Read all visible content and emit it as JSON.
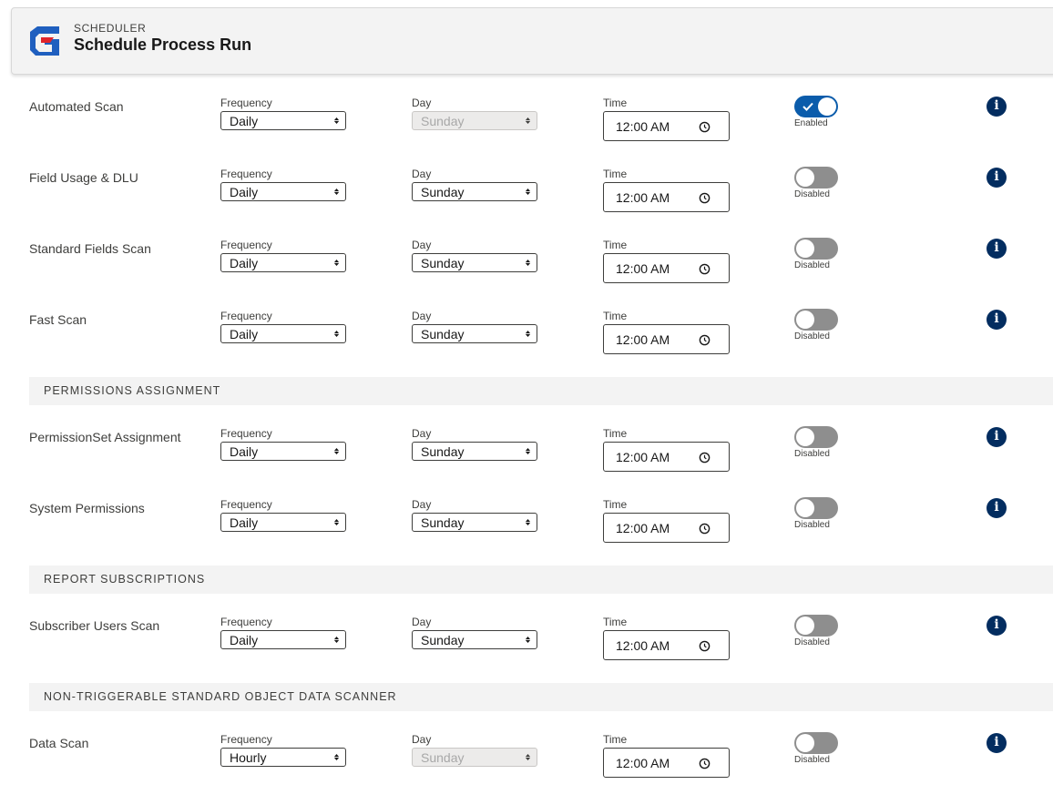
{
  "header": {
    "eyebrow": "SCHEDULER",
    "title": "Schedule Process Run"
  },
  "colors": {
    "accent": "#0b5cab",
    "info": "#032d60",
    "toggle_off": "#8e8e8e",
    "logo_blue": "#1f5fbf",
    "logo_red": "#e0252b"
  },
  "labels": {
    "frequency": "Frequency",
    "day": "Day",
    "time": "Time"
  },
  "sections": [
    {
      "title": "PERMISSIONS ASSIGNMENT"
    },
    {
      "title": "REPORT SUBSCRIPTIONS"
    },
    {
      "title": "NON-TRIGGERABLE STANDARD OBJECT DATA SCANNER"
    }
  ],
  "rows": [
    {
      "name": "Automated Scan",
      "frequency": "Daily",
      "day": "Sunday",
      "day_disabled": true,
      "time": "12:00 AM",
      "enabled": true,
      "status": "Enabled"
    },
    {
      "name": "Field Usage & DLU",
      "frequency": "Daily",
      "day": "Sunday",
      "day_disabled": false,
      "time": "12:00 AM",
      "enabled": false,
      "status": "Disabled"
    },
    {
      "name": "Standard Fields Scan",
      "frequency": "Daily",
      "day": "Sunday",
      "day_disabled": false,
      "time": "12:00 AM",
      "enabled": false,
      "status": "Disabled"
    },
    {
      "name": "Fast Scan",
      "frequency": "Daily",
      "day": "Sunday",
      "day_disabled": false,
      "time": "12:00 AM",
      "enabled": false,
      "status": "Disabled"
    },
    {
      "name": "PermissionSet Assignment",
      "frequency": "Daily",
      "day": "Sunday",
      "day_disabled": false,
      "time": "12:00 AM",
      "enabled": false,
      "status": "Disabled"
    },
    {
      "name": "System Permissions",
      "frequency": "Daily",
      "day": "Sunday",
      "day_disabled": false,
      "time": "12:00 AM",
      "enabled": false,
      "status": "Disabled"
    },
    {
      "name": "Subscriber Users Scan",
      "frequency": "Daily",
      "day": "Sunday",
      "day_disabled": false,
      "time": "12:00 AM",
      "enabled": false,
      "status": "Disabled"
    },
    {
      "name": "Data Scan",
      "frequency": "Hourly",
      "day": "Sunday",
      "day_disabled": true,
      "time": "12:00 AM",
      "enabled": false,
      "status": "Disabled"
    }
  ]
}
